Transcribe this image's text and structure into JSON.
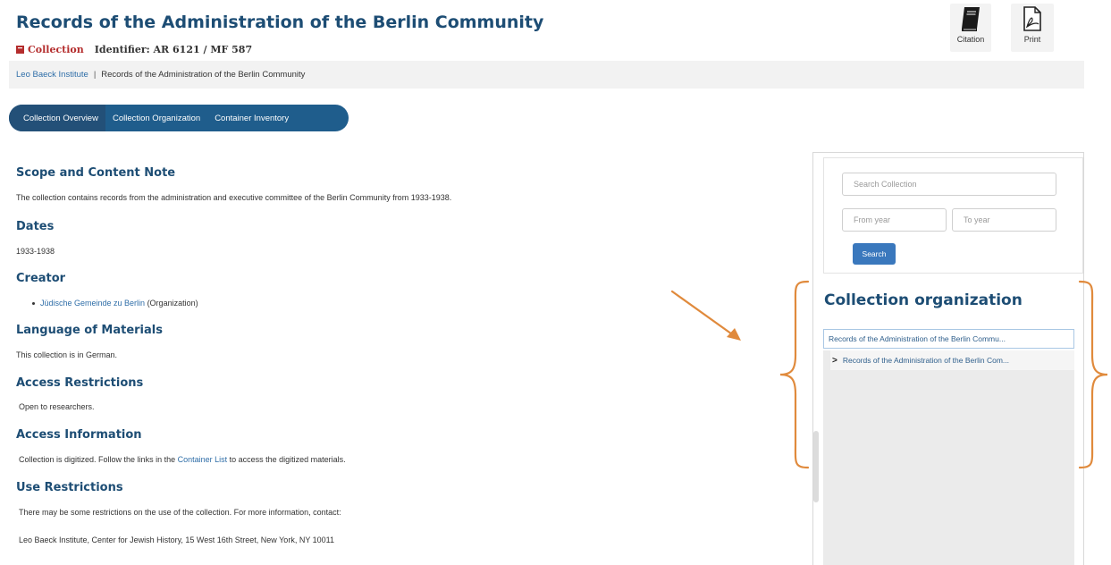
{
  "page": {
    "title": "Records of the Administration of the Berlin Community",
    "badge_label": "Collection",
    "identifier": "Identifier: AR 6121 / MF 587"
  },
  "toolbar": {
    "citation_label": "Citation",
    "print_label": "Print"
  },
  "breadcrumb": {
    "items": [
      "Leo Baeck Institute",
      "Records of the Administration of the Berlin Community"
    ],
    "separator": "|"
  },
  "tabs": [
    "Collection Overview",
    "Collection Organization",
    "Container Inventory"
  ],
  "sections": {
    "scope": {
      "heading": "Scope and Content Note",
      "text": "The collection contains records from the administration and executive committee of the Berlin Community from 1933-1938."
    },
    "dates": {
      "heading": "Dates",
      "text": "1933-1938"
    },
    "creator": {
      "heading": "Creator",
      "link": "Jüdische Gemeinde zu Berlin",
      "suffix": " (Organization)"
    },
    "language": {
      "heading": "Language of Materials",
      "text": "This collection is in German."
    },
    "access_restrictions": {
      "heading": "Access Restrictions",
      "text": "Open to researchers."
    },
    "access_information": {
      "heading": "Access Information",
      "text_before": "Collection is digitized. Follow the links in the ",
      "link": "Container List",
      "text_after": " to access the digitized materials."
    },
    "use_restrictions": {
      "heading": "Use Restrictions",
      "text": "There may be some restrictions on the use of the collection. For more information, contact:",
      "address": "Leo Baeck Institute, Center for Jewish History, 15 West 16th Street, New York, NY 10011"
    }
  },
  "sidebar": {
    "search_placeholder": "Search Collection",
    "from_placeholder": "From year",
    "to_placeholder": "To year",
    "search_button": "Search",
    "org_title": "Collection organization",
    "tree_root": "Records of the Administration of the Berlin Commu...",
    "tree_child": "Records of the Administration of the Berlin Com..."
  },
  "colors": {
    "heading": "#1d4d74",
    "tab_bar": "#1f5d8c",
    "link": "#2f6ea8",
    "badge": "#b42d2d",
    "annotation": "#e08a3c",
    "button": "#3a78bd"
  },
  "icons": {
    "citation": "book-icon",
    "print": "pdf-icon",
    "badge": "archive-box-icon",
    "tree": "chevron-right-icon",
    "annotation_arrow": "arrow-icon",
    "annotation_braces": "curly-brace-icon"
  }
}
